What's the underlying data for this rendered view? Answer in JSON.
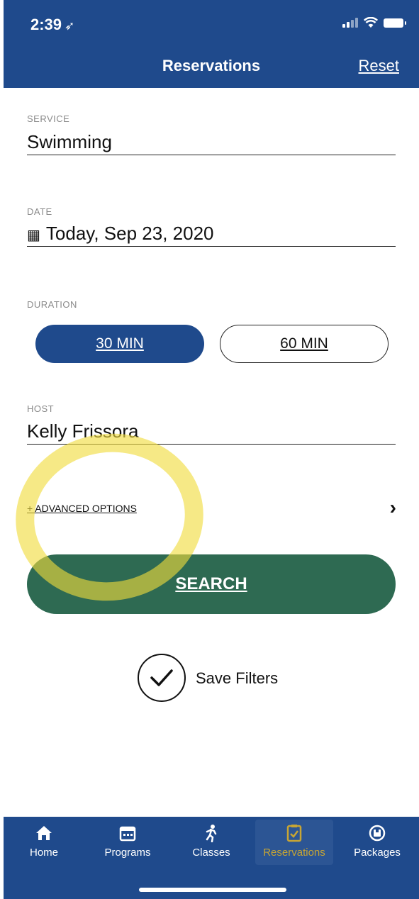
{
  "status": {
    "time": "2:39",
    "location_arrow": "location-arrow-icon"
  },
  "header": {
    "title": "Reservations",
    "reset_label": "Reset"
  },
  "service": {
    "label": "SERVICE",
    "value": "Swimming"
  },
  "date": {
    "label": "DATE",
    "value": "Today, Sep 23, 2020",
    "icon": "calendar-icon"
  },
  "duration": {
    "label": "DURATION",
    "options": [
      "30 MIN",
      "60 MIN"
    ],
    "selected": "30 MIN"
  },
  "host": {
    "label": "HOST",
    "value": "Kelly Frissora"
  },
  "advanced": {
    "label": "+ ADVANCED OPTIONS"
  },
  "search": {
    "label": "SEARCH"
  },
  "save_filters": {
    "label": "Save Filters",
    "checked": true
  },
  "tabs": [
    {
      "label": "Home",
      "icon": "home-icon"
    },
    {
      "label": "Programs",
      "icon": "calendar-icon"
    },
    {
      "label": "Classes",
      "icon": "runner-icon"
    },
    {
      "label": "Reservations",
      "icon": "clipboard-check-icon"
    },
    {
      "label": "Packages",
      "icon": "package-icon"
    }
  ],
  "colors": {
    "brand": "#1f4a8c",
    "search": "#2e6a52",
    "active_tab": "#c7a534",
    "highlight": "#f0dc3c"
  }
}
